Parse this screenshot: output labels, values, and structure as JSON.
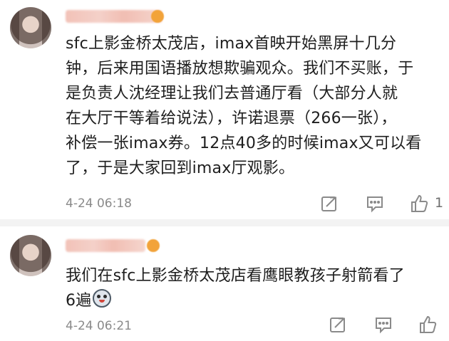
{
  "comments": [
    {
      "text": "sfc上影金桥太茂店，imax首映开始黑屏十几分\n钟，后来用国语播放想欺骗观众。我们不买账，于\n是负责人沈经理让我们去普通厅看（大部分人就\n在大厅干等着给说法），许诺退票（266一张），\n补偿一张imax券。12点40多的时候imax又可以看\n了，于是大家回到imax厅观影。",
      "time": "4-24 06:18",
      "likes": "1",
      "icons": [
        "share-icon",
        "reply-icon",
        "like-icon"
      ]
    },
    {
      "text": "我们在sfc上影金桥太茂店看鹰眼教孩子射箭看了\n6遍",
      "time": "4-24 06:21",
      "icons": [
        "share-icon",
        "reply-icon",
        "like-icon"
      ],
      "emoji": "surprised-face-emoji"
    }
  ],
  "colors": {
    "text": "#1e1e1e",
    "timestamp": "#8a8a8a",
    "icon": "#8a8a8a",
    "divider": "#f3f3f3"
  }
}
